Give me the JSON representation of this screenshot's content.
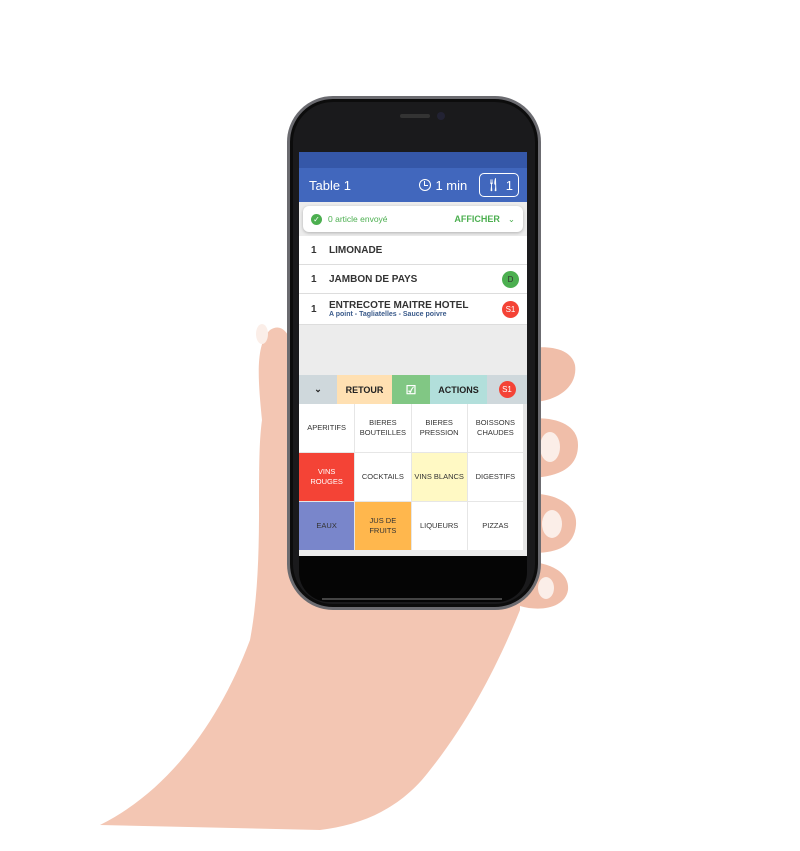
{
  "header": {
    "title": "Table 1",
    "timer": "1 min",
    "covers": "1"
  },
  "sent_bar": {
    "message": "0 article envoyé",
    "show_label": "AFFICHER"
  },
  "order_lines": [
    {
      "qty": "1",
      "name": "LIMONADE",
      "detail": "",
      "badge": ""
    },
    {
      "qty": "1",
      "name": "JAMBON DE PAYS",
      "detail": "",
      "badge": "D",
      "badge_color": "#4caf50"
    },
    {
      "qty": "1",
      "name": "ENTRECOTE MAITRE HOTEL",
      "detail": "A point - Tagliatelles - Sauce poivre",
      "badge": "S1",
      "badge_color": "#f44336"
    }
  ],
  "action_bar": {
    "retour": "RETOUR",
    "actions": "ACTIONS",
    "step": "S1"
  },
  "categories": [
    {
      "label": "APERITIFS",
      "color": "#ffffff"
    },
    {
      "label": "BIERES BOUTEILLES",
      "color": "#ffffff"
    },
    {
      "label": "BIERES PRESSION",
      "color": "#ffffff"
    },
    {
      "label": "BOISSONS CHAUDES",
      "color": "#ffffff"
    },
    {
      "label": "VINS ROUGES",
      "color": "#f44336"
    },
    {
      "label": "COCKTAILS",
      "color": "#ffffff"
    },
    {
      "label": "VINS BLANCS",
      "color": "#fff9c4"
    },
    {
      "label": "DIGESTIFS",
      "color": "#ffffff"
    },
    {
      "label": "EAUX",
      "color": "#7986cb"
    },
    {
      "label": "JUS DE FRUITS",
      "color": "#ffb74d"
    },
    {
      "label": "LIQUEURS",
      "color": "#ffffff"
    },
    {
      "label": "PIZZAS",
      "color": "#ffffff"
    }
  ]
}
